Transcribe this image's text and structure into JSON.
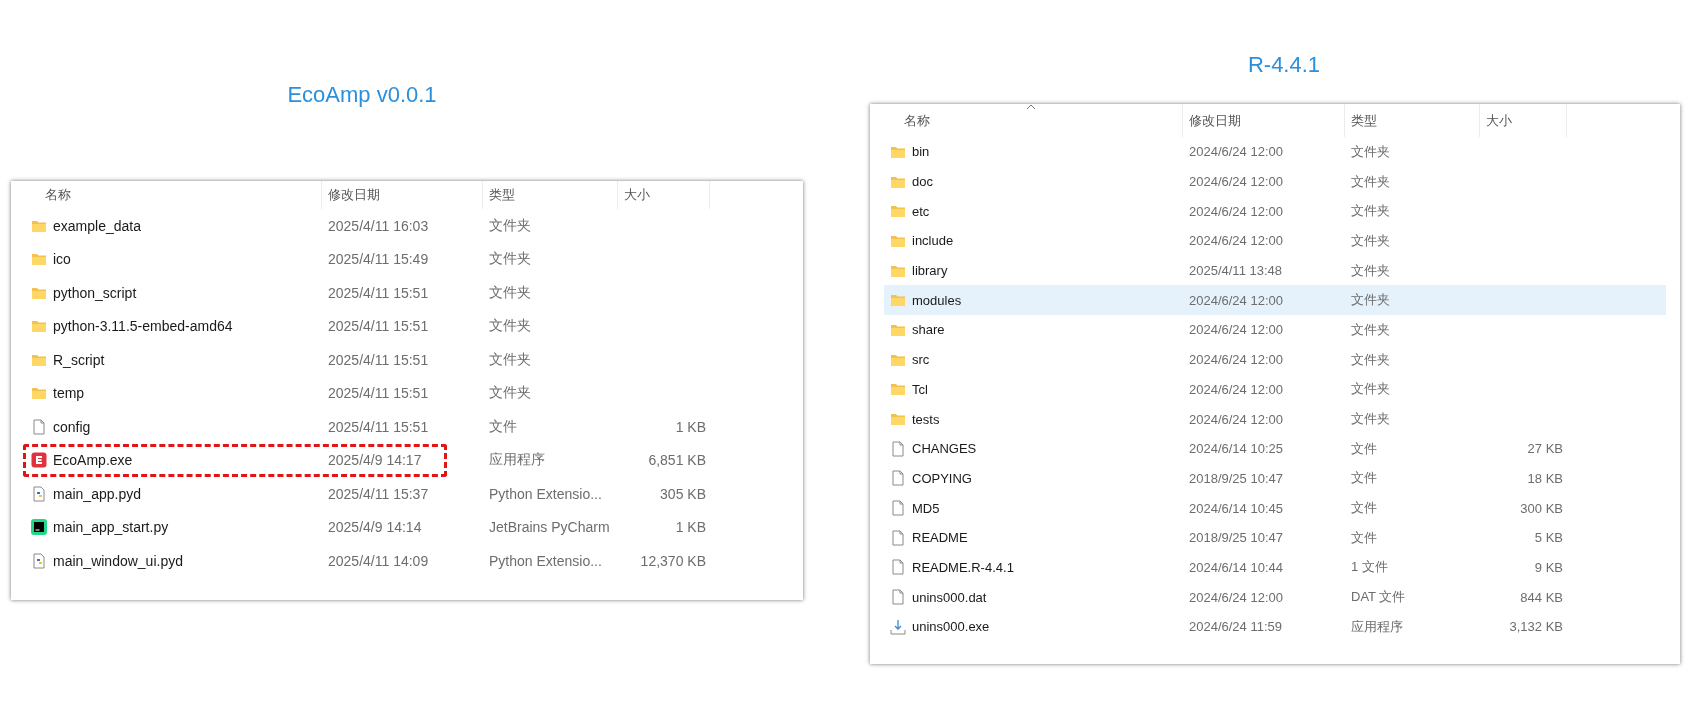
{
  "panels": [
    {
      "title": "EcoAmp v0.0.1",
      "columns": [
        {
          "label": "名称",
          "sorted": false
        },
        {
          "label": "修改日期",
          "sorted": false
        },
        {
          "label": "类型",
          "sorted": false
        },
        {
          "label": "大小",
          "sorted": false
        }
      ],
      "rows": [
        {
          "kind": "folder",
          "name": "example_data",
          "date": "2025/4/11 16:03",
          "type": "文件夹",
          "selected": false,
          "highlighted": false
        },
        {
          "kind": "folder",
          "name": "ico",
          "date": "2025/4/11 15:49",
          "type": "文件夹",
          "selected": false,
          "highlighted": false
        },
        {
          "kind": "folder",
          "name": "python_script",
          "date": "2025/4/11 15:51",
          "type": "文件夹",
          "selected": false,
          "highlighted": false
        },
        {
          "kind": "folder",
          "name": "python-3.11.5-embed-amd64",
          "date": "2025/4/11 15:51",
          "type": "文件夹",
          "selected": false,
          "highlighted": false
        },
        {
          "kind": "folder",
          "name": "R_script",
          "date": "2025/4/11 15:51",
          "type": "文件夹",
          "selected": false,
          "highlighted": false
        },
        {
          "kind": "folder",
          "name": "temp",
          "date": "2025/4/11 15:51",
          "type": "文件夹",
          "selected": false,
          "highlighted": false
        },
        {
          "kind": "file",
          "name": "config",
          "date": "2025/4/11 15:51",
          "type": "文件",
          "size": "1 KB",
          "selected": false,
          "highlighted": false
        },
        {
          "kind": "app",
          "name": "EcoAmp.exe",
          "date": "2025/4/9 14:17",
          "type": "应用程序",
          "size": "6,851 KB",
          "selected": false,
          "highlighted": true
        },
        {
          "kind": "python",
          "name": "main_app.pyd",
          "date": "2025/4/11 15:37",
          "type": "Python Extensio...",
          "size": "305 KB",
          "selected": false,
          "highlighted": false
        },
        {
          "kind": "pycharm",
          "name": "main_app_start.py",
          "date": "2025/4/9 14:14",
          "type": "JetBrains PyCharm",
          "size": "1 KB",
          "selected": false,
          "highlighted": false
        },
        {
          "kind": "python",
          "name": "main_window_ui.pyd",
          "date": "2025/4/11 14:09",
          "type": "Python Extensio...",
          "size": "12,370 KB",
          "selected": false,
          "highlighted": false
        }
      ]
    },
    {
      "title": "R-4.4.1",
      "columns": [
        {
          "label": "名称",
          "sorted": true
        },
        {
          "label": "修改日期",
          "sorted": false
        },
        {
          "label": "类型",
          "sorted": false
        },
        {
          "label": "大小",
          "sorted": false
        }
      ],
      "rows": [
        {
          "kind": "folder",
          "name": "bin",
          "date": "2024/6/24 12:00",
          "type": "文件夹",
          "selected": false,
          "highlighted": false
        },
        {
          "kind": "folder",
          "name": "doc",
          "date": "2024/6/24 12:00",
          "type": "文件夹",
          "selected": false,
          "highlighted": false
        },
        {
          "kind": "folder",
          "name": "etc",
          "date": "2024/6/24 12:00",
          "type": "文件夹",
          "selected": false,
          "highlighted": false
        },
        {
          "kind": "folder",
          "name": "include",
          "date": "2024/6/24 12:00",
          "type": "文件夹",
          "selected": false,
          "highlighted": false
        },
        {
          "kind": "folder",
          "name": "library",
          "date": "2025/4/11 13:48",
          "type": "文件夹",
          "selected": false,
          "highlighted": false
        },
        {
          "kind": "folder",
          "name": "modules",
          "date": "2024/6/24 12:00",
          "type": "文件夹",
          "selected": true,
          "highlighted": false
        },
        {
          "kind": "folder",
          "name": "share",
          "date": "2024/6/24 12:00",
          "type": "文件夹",
          "selected": false,
          "highlighted": false
        },
        {
          "kind": "folder",
          "name": "src",
          "date": "2024/6/24 12:00",
          "type": "文件夹",
          "selected": false,
          "highlighted": false
        },
        {
          "kind": "folder",
          "name": "Tcl",
          "date": "2024/6/24 12:00",
          "type": "文件夹",
          "selected": false,
          "highlighted": false
        },
        {
          "kind": "folder",
          "name": "tests",
          "date": "2024/6/24 12:00",
          "type": "文件夹",
          "selected": false,
          "highlighted": false
        },
        {
          "kind": "file",
          "name": "CHANGES",
          "date": "2024/6/14 10:25",
          "type": "文件",
          "size": "27 KB",
          "selected": false,
          "highlighted": false
        },
        {
          "kind": "file",
          "name": "COPYING",
          "date": "2018/9/25 10:47",
          "type": "文件",
          "size": "18 KB",
          "selected": false,
          "highlighted": false
        },
        {
          "kind": "file",
          "name": "MD5",
          "date": "2024/6/14 10:45",
          "type": "文件",
          "size": "300 KB",
          "selected": false,
          "highlighted": false
        },
        {
          "kind": "file",
          "name": "README",
          "date": "2018/9/25 10:47",
          "type": "文件",
          "size": "5 KB",
          "selected": false,
          "highlighted": false
        },
        {
          "kind": "file",
          "name": "README.R-4.4.1",
          "date": "2024/6/14 10:44",
          "type": "1 文件",
          "size": "9 KB",
          "selected": false,
          "highlighted": false
        },
        {
          "kind": "file",
          "name": "unins000.dat",
          "date": "2024/6/24 12:00",
          "type": "DAT 文件",
          "size": "844 KB",
          "selected": false,
          "highlighted": false
        },
        {
          "kind": "installer",
          "name": "unins000.exe",
          "date": "2024/6/24 11:59",
          "type": "应用程序",
          "size": "3,132 KB",
          "selected": false,
          "highlighted": false
        }
      ]
    }
  ]
}
